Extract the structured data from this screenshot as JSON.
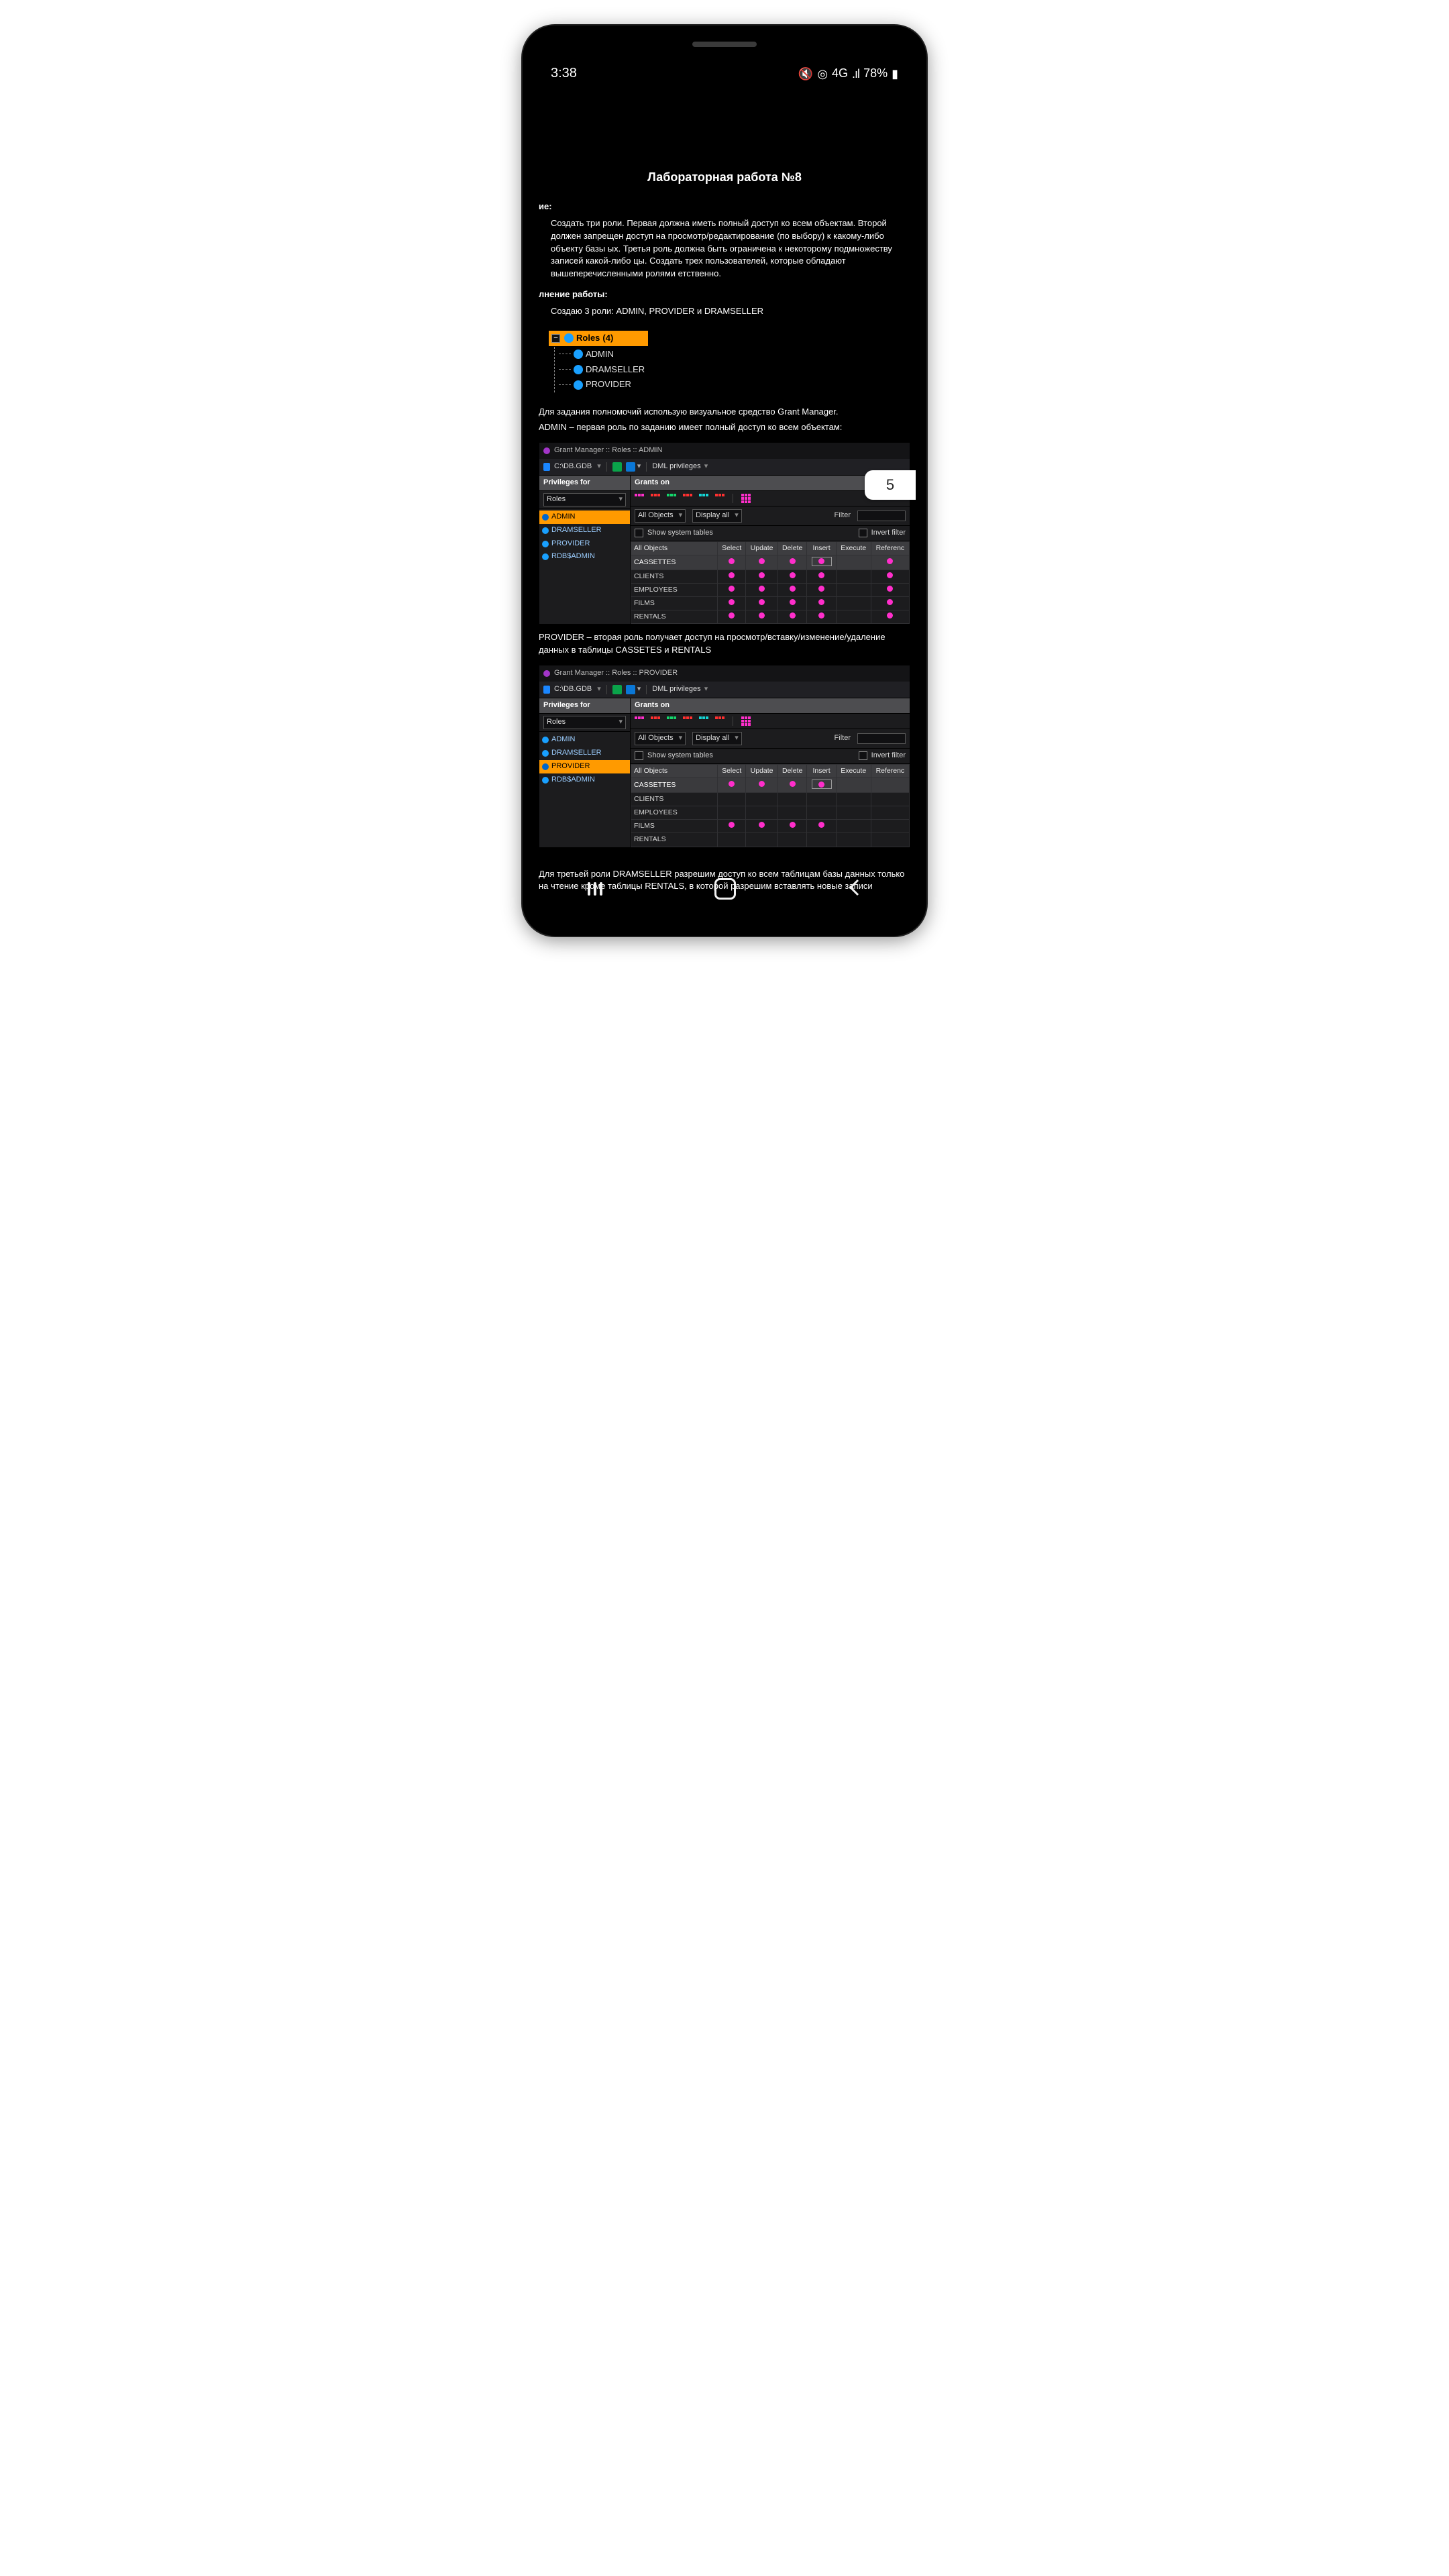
{
  "status": {
    "time": "3:38",
    "network": "4G",
    "battery": "78%"
  },
  "page_badge": "5",
  "doc": {
    "title": "Лабораторная работа №8",
    "task_h": "ие:",
    "task_body": "Создать три роли. Первая должна иметь полный доступ ко всем объектам. Второй должен запрещен доступ на просмотр/редактирование (по выбору) к какому-либо объекту базы ых. Третья роль должна быть ограничена к некоторому подмножеству записей какой-либо цы. Создать трех пользователей, которые обладают вышеперечисленными ролями етственно.",
    "work_h": "лнение работы:",
    "work_l1": "Создаю 3 роли: ADMIN, PROVIDER и DRAMSELLER",
    "tree": {
      "root": "Roles",
      "count": "(4)",
      "items": [
        "ADMIN",
        "DRAMSELLER",
        "PROVIDER"
      ]
    },
    "para2a": "Для задания полномочий использую визуальное средство Grant Manager.",
    "para2b": "ADMIN – первая роль по заданию имеет полный доступ ко всем объектам:",
    "para3": "PROVIDER – вторая роль получает доступ на просмотр/вставку/изменение/удаление данных в таблицы CASSETES и RENTALS",
    "para4": "Для третьей роли DRAMSELLER разрешим доступ ко всем таблицам базы данных только на чтение кроме таблицы RENTALS, в которой разрешим вставлять новые записи"
  },
  "gm_common": {
    "db_path": "C:\\DB.GDB",
    "dml_btn": "DML privileges",
    "left_header": "Privileges for",
    "right_header": "Grants on",
    "roles_sel": "Roles",
    "all_objects": "All Objects",
    "display_all": "Display all",
    "filter_label": "Filter",
    "show_system": "Show system tables",
    "invert_filter": "Invert filter",
    "cols": [
      "All Objects",
      "Select",
      "Update",
      "Delete",
      "Insert",
      "Execute",
      "Referenc"
    ],
    "rows": [
      "CASSETTES",
      "CLIENTS",
      "EMPLOYEES",
      "FILMS",
      "RENTALS"
    ],
    "roles_list": [
      "ADMIN",
      "DRAMSELLER",
      "PROVIDER",
      "RDB$ADMIN"
    ]
  },
  "gm1": {
    "title": "Grant Manager :: Roles :: ADMIN",
    "selected_role": "ADMIN",
    "grants": {
      "CASSETTES": {
        "Select": true,
        "Update": true,
        "Delete": true,
        "Insert": "boxed",
        "Execute": false,
        "Referenc": true
      },
      "CLIENTS": {
        "Select": true,
        "Update": true,
        "Delete": true,
        "Insert": true,
        "Execute": false,
        "Referenc": true
      },
      "EMPLOYEES": {
        "Select": true,
        "Update": true,
        "Delete": true,
        "Insert": true,
        "Execute": false,
        "Referenc": true
      },
      "FILMS": {
        "Select": true,
        "Update": true,
        "Delete": true,
        "Insert": true,
        "Execute": false,
        "Referenc": true
      },
      "RENTALS": {
        "Select": true,
        "Update": true,
        "Delete": true,
        "Insert": true,
        "Execute": false,
        "Referenc": true
      }
    }
  },
  "gm2": {
    "title": "Grant Manager :: Roles :: PROVIDER",
    "selected_role": "PROVIDER",
    "grants": {
      "CASSETTES": {
        "Select": true,
        "Update": true,
        "Delete": true,
        "Insert": "boxed",
        "Execute": false,
        "Referenc": false
      },
      "CLIENTS": {
        "Select": false,
        "Update": false,
        "Delete": false,
        "Insert": false,
        "Execute": false,
        "Referenc": false
      },
      "EMPLOYEES": {
        "Select": false,
        "Update": false,
        "Delete": false,
        "Insert": false,
        "Execute": false,
        "Referenc": false
      },
      "FILMS": {
        "Select": true,
        "Update": true,
        "Delete": true,
        "Insert": true,
        "Execute": false,
        "Referenc": false
      },
      "RENTALS": {
        "Select": false,
        "Update": false,
        "Delete": false,
        "Insert": false,
        "Execute": false,
        "Referenc": false
      }
    }
  }
}
